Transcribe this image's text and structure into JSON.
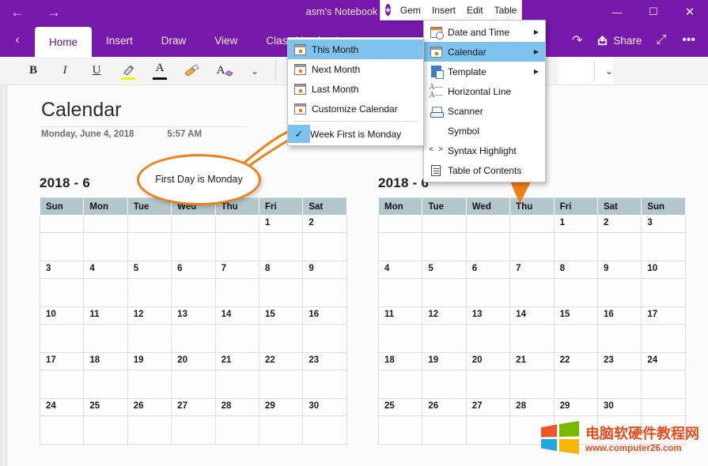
{
  "titlebar": {
    "back_icon": "←",
    "forward_icon": "→",
    "title": "asm's Notebook » Qu",
    "minimize": "—",
    "maximize": "☐",
    "close": "✕"
  },
  "ribbon": {
    "back_chevron": "‹",
    "tabs": [
      {
        "label": "Home",
        "active": true
      },
      {
        "label": "Insert",
        "active": false
      },
      {
        "label": "Draw",
        "active": false
      },
      {
        "label": "View",
        "active": false
      },
      {
        "label": "Class Notebook",
        "active": false
      }
    ],
    "redo_icon": "↷",
    "share_icon": "share-icon",
    "share_label": "Share",
    "expand_icon": "⤢",
    "more_icon": "•••",
    "tools": [
      {
        "name": "bold",
        "glyph": "B"
      },
      {
        "name": "italic",
        "glyph": "I"
      },
      {
        "name": "underline",
        "glyph": "U"
      },
      {
        "name": "highlight",
        "glyph": "✎"
      },
      {
        "name": "font-color",
        "glyph": "A"
      },
      {
        "name": "format-painter",
        "glyph": "🖌"
      },
      {
        "name": "clear-formatting",
        "glyph": "A"
      }
    ],
    "overflow_chevron": "⌄",
    "right_chevron": "⌄"
  },
  "gembar": {
    "logo": "gem-icon",
    "items": [
      "Gem",
      "Insert",
      "Edit",
      "Table"
    ]
  },
  "insert_menu": {
    "items": [
      {
        "label": "Date and Time",
        "icon": "date-time-icon",
        "submenu": true,
        "selected": false
      },
      {
        "label": "Calendar",
        "icon": "calendar-icon",
        "submenu": true,
        "selected": true
      },
      {
        "label": "Template",
        "icon": "template-icon",
        "submenu": true,
        "selected": false
      },
      {
        "label": "Horizontal Line",
        "icon": "horizontal-line-icon",
        "submenu": false,
        "selected": false
      },
      {
        "label": "Scanner",
        "icon": "scanner-icon",
        "submenu": false,
        "selected": false
      },
      {
        "label": "Symbol",
        "icon": "none",
        "submenu": false,
        "selected": false
      },
      {
        "label": "Syntax Highlight",
        "icon": "code-icon",
        "submenu": false,
        "selected": false
      },
      {
        "label": "Table of Contents",
        "icon": "toc-icon",
        "submenu": false,
        "selected": false
      }
    ]
  },
  "calendar_menu": {
    "items": [
      {
        "label": "This Month",
        "icon": "calendar-icon",
        "selected": true,
        "checked": false
      },
      {
        "label": "Next Month",
        "icon": "calendar-icon",
        "selected": false,
        "checked": false
      },
      {
        "label": "Last Month",
        "icon": "calendar-icon",
        "selected": false,
        "checked": false
      },
      {
        "label": "Customize Calendar",
        "icon": "calendar-icon",
        "selected": false,
        "checked": false
      }
    ],
    "checked_item": {
      "label": "Week First is Monday",
      "icon": "check-icon",
      "checked": true
    }
  },
  "page": {
    "title": "Calendar",
    "date": "Monday, June 4, 2018",
    "time": "5:57 AM"
  },
  "callout": {
    "text": "First Day is Monday",
    "color": "#ef8017"
  },
  "calendars": [
    {
      "id": "calendar-sunday-first",
      "heading": "2018 - 6",
      "headers": [
        "Sun",
        "Mon",
        "Tue",
        "Wed",
        "Thu",
        "Fri",
        "Sat"
      ],
      "weeks": [
        [
          "",
          "",
          "",
          "",
          "",
          "1",
          "2"
        ],
        [
          "3",
          "4",
          "5",
          "6",
          "7",
          "8",
          "9"
        ],
        [
          "10",
          "11",
          "12",
          "13",
          "14",
          "15",
          "16"
        ],
        [
          "17",
          "18",
          "19",
          "20",
          "21",
          "22",
          "23"
        ],
        [
          "24",
          "25",
          "26",
          "27",
          "28",
          "29",
          "30"
        ]
      ]
    },
    {
      "id": "calendar-monday-first",
      "heading": "2018 - 6",
      "headers": [
        "Mon",
        "Tue",
        "Wed",
        "Thu",
        "Fri",
        "Sat",
        "Sun"
      ],
      "weeks": [
        [
          "",
          "",
          "",
          "",
          "1",
          "2",
          "3"
        ],
        [
          "4",
          "5",
          "6",
          "7",
          "8",
          "9",
          "10"
        ],
        [
          "11",
          "12",
          "13",
          "14",
          "15",
          "16",
          "17"
        ],
        [
          "18",
          "19",
          "20",
          "21",
          "22",
          "23",
          "24"
        ],
        [
          "25",
          "26",
          "27",
          "28",
          "29",
          "30",
          ""
        ]
      ]
    }
  ],
  "watermark": {
    "cn_text": "电脑软硬件教程网",
    "url": "www.computer26.com",
    "color": "#e94d1f"
  },
  "colors": {
    "accent_purple": "#7719aa",
    "menu_highlight": "#7ec3ee",
    "table_header": "#b3c6cc",
    "callout_orange": "#ef8017"
  }
}
